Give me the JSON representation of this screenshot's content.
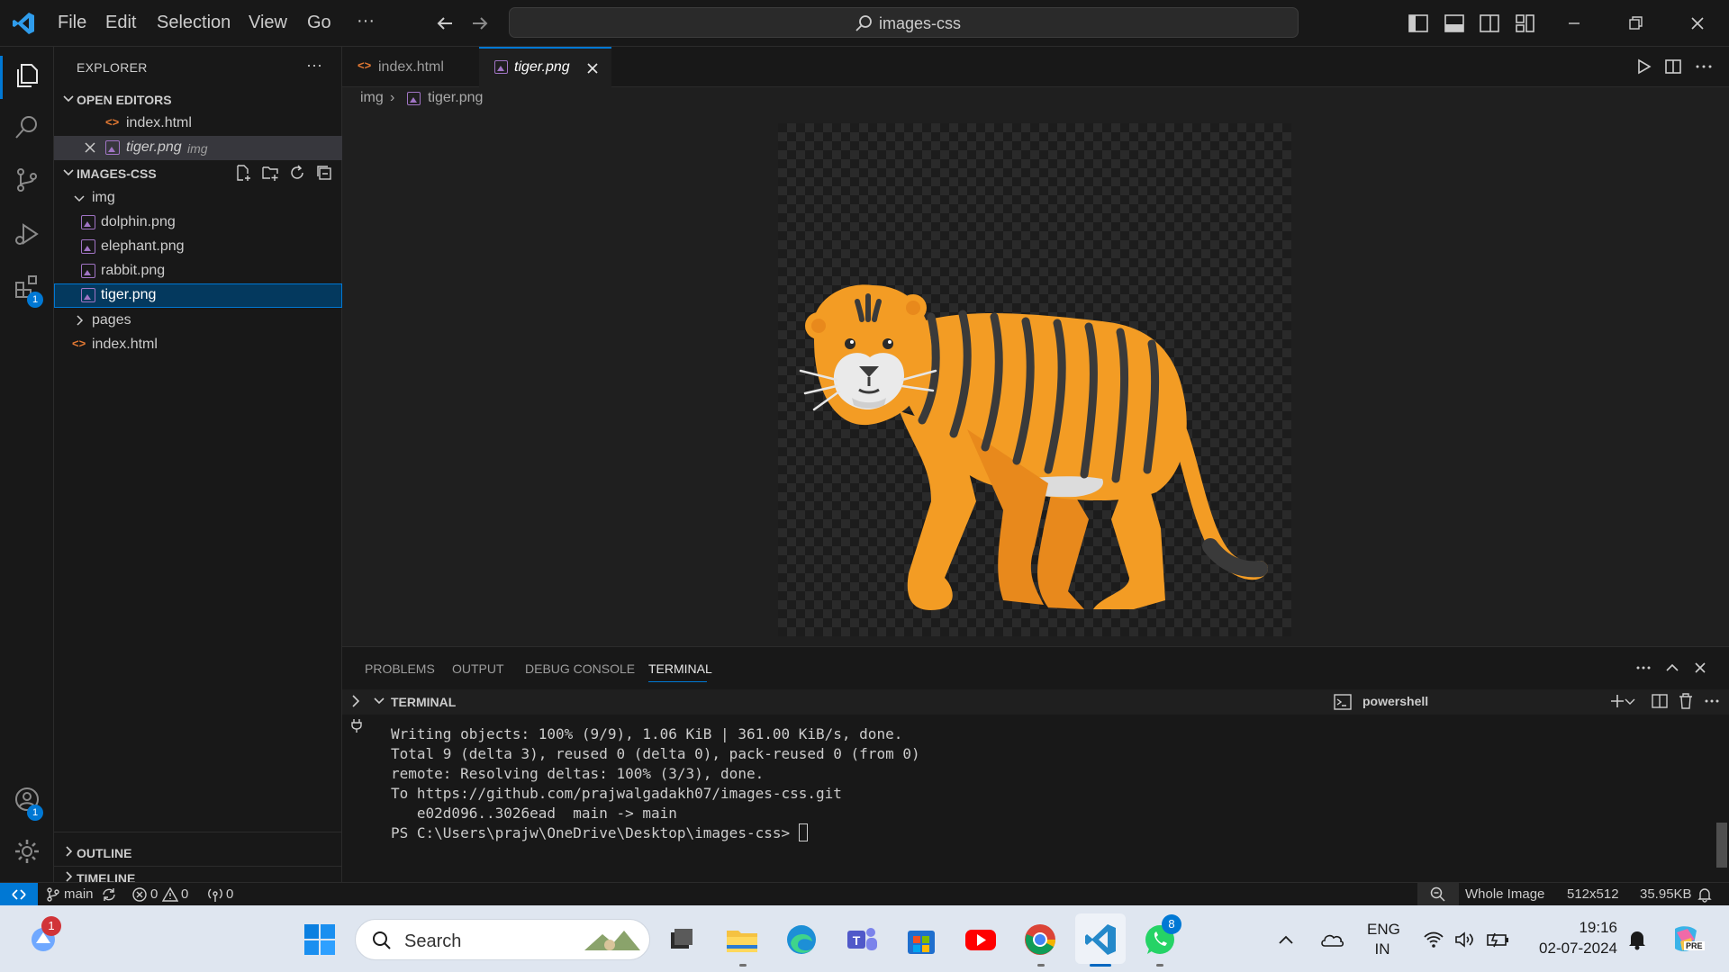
{
  "menu": [
    "File",
    "Edit",
    "Selection",
    "View",
    "Go",
    "···"
  ],
  "command_center": {
    "label": "images-css"
  },
  "activity_badges": {
    "extensions": "1",
    "accounts": "1"
  },
  "explorer": {
    "title": "EXPLORER",
    "more": "···",
    "open_editors_title": "OPEN EDITORS",
    "open_editors": [
      {
        "name": "index.html",
        "type": "html"
      },
      {
        "name": "tiger.png",
        "type": "image",
        "folder": "img"
      }
    ],
    "workspace_title": "IMAGES-CSS",
    "tree": {
      "img_folder": "img",
      "img_files": [
        "dolphin.png",
        "elephant.png",
        "rabbit.png",
        "tiger.png"
      ],
      "pages_folder": "pages",
      "index": "index.html"
    },
    "outline": "OUTLINE",
    "timeline": "TIMELINE"
  },
  "tabs": [
    {
      "label": "index.html",
      "type": "html"
    },
    {
      "label": "tiger.png",
      "type": "image",
      "active": true
    }
  ],
  "breadcrumb": {
    "folder": "img",
    "file": "tiger.png"
  },
  "panel": {
    "tabs": [
      "PROBLEMS",
      "OUTPUT",
      "DEBUG CONSOLE",
      "TERMINAL"
    ],
    "active_tab": "TERMINAL",
    "terminal_title": "TERMINAL",
    "profile": "powershell",
    "lines": [
      "Writing objects: 100% (9/9), 1.06 KiB | 361.00 KiB/s, done.",
      "Total 9 (delta 3), reused 0 (delta 0), pack-reused 0 (from 0)",
      "remote: Resolving deltas: 100% (3/3), done.",
      "To https://github.com/prajwalgadakh07/images-css.git",
      "   e02d096..3026ead  main -> main"
    ],
    "prompt": "PS C:\\Users\\prajw\\OneDrive\\Desktop\\images-css> "
  },
  "status": {
    "branch": "main",
    "errors": "0",
    "warnings": "0",
    "ports": "0",
    "zoom_mode": "Whole Image",
    "dimensions": "512x512",
    "size": "35.95KB"
  },
  "taskbar": {
    "search_label": "Search",
    "notification_badge": "1",
    "whatsapp_badge": "8",
    "lang_top": "ENG",
    "lang_bottom": "IN",
    "time": "19:16",
    "date": "02-07-2024",
    "copilot_tag": "PRE"
  },
  "colors": {
    "accent": "#0078d4",
    "tiger_orange": "#f39c24",
    "stripe": "#3a3a3a"
  }
}
